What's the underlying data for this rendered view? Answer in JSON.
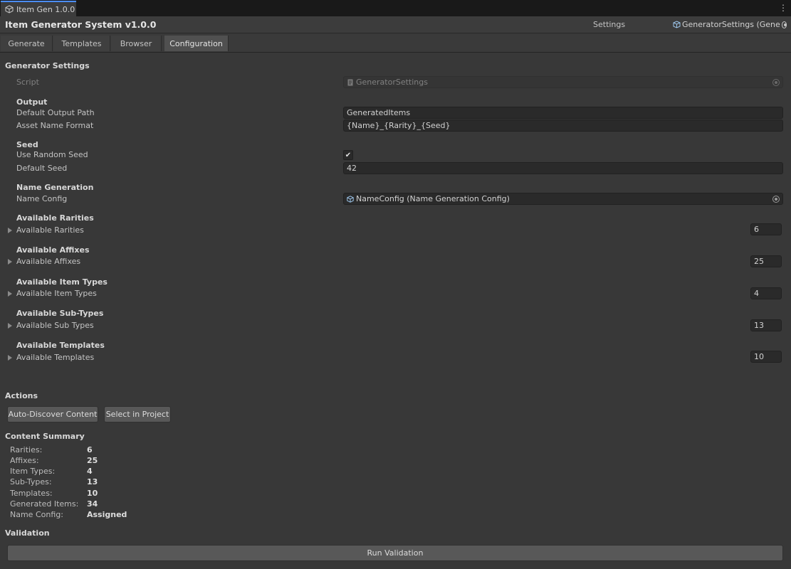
{
  "window_tab": {
    "title": "Item Gen 1.0.0",
    "icon": "cube-icon"
  },
  "header": {
    "title": "Item Generator System v1.0.0",
    "settings_label": "Settings",
    "object_field": "GeneratorSettings (Gene",
    "object_icon": "scriptable-object-icon"
  },
  "tabs": [
    "Generate",
    "Templates",
    "Browser",
    "Configuration"
  ],
  "active_tab": "Configuration",
  "section_title": "Generator Settings",
  "script": {
    "label": "Script",
    "value": "GeneratorSettings"
  },
  "output": {
    "header": "Output",
    "path_label": "Default Output Path",
    "path_value": "GeneratedItems",
    "format_label": "Asset Name Format",
    "format_value": "{Name}_{Rarity}_{Seed}"
  },
  "seed": {
    "header": "Seed",
    "random_label": "Use Random Seed",
    "random_checked": true,
    "default_label": "Default Seed",
    "default_value": "42"
  },
  "name_generation": {
    "header": "Name Generation",
    "config_label": "Name Config",
    "config_value": "NameConfig (Name Generation Config)"
  },
  "lists": [
    {
      "header": "Available Rarities",
      "label": "Available Rarities",
      "count": "6"
    },
    {
      "header": "Available Affixes",
      "label": "Available Affixes",
      "count": "25"
    },
    {
      "header": "Available Item Types",
      "label": "Available Item Types",
      "count": "4"
    },
    {
      "header": "Available Sub-Types",
      "label": "Available Sub Types",
      "count": "13"
    },
    {
      "header": "Available Templates",
      "label": "Available Templates",
      "count": "10"
    }
  ],
  "actions": {
    "header": "Actions",
    "auto_discover": "Auto-Discover Content",
    "select_in_project": "Select in Project"
  },
  "summary": {
    "header": "Content Summary",
    "rows": [
      {
        "key": "Rarities:",
        "value": "6"
      },
      {
        "key": "Affixes:",
        "value": "25"
      },
      {
        "key": "Item Types:",
        "value": "4"
      },
      {
        "key": "Sub-Types:",
        "value": "13"
      },
      {
        "key": "Templates:",
        "value": "10"
      },
      {
        "key": "Generated Items:",
        "value": "34"
      },
      {
        "key": "Name Config:",
        "value": "Assigned"
      }
    ]
  },
  "validation": {
    "header": "Validation",
    "run_button": "Run Validation"
  }
}
